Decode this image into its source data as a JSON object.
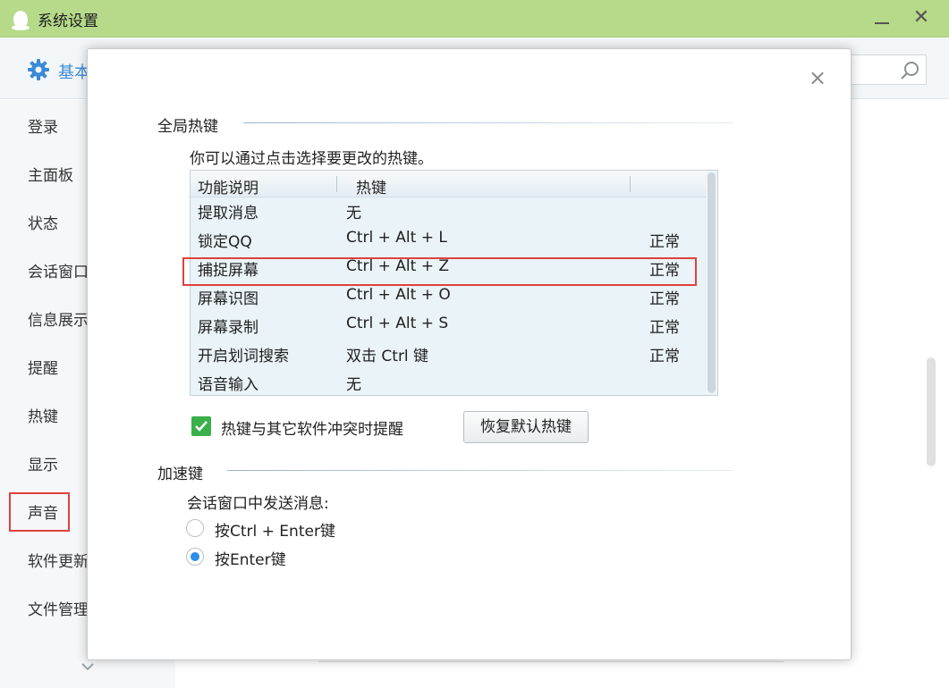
{
  "window": {
    "title": "系统设置",
    "minimize_icon": "minimize-icon",
    "close_glyph": "✕"
  },
  "background": {
    "header_label": "基本",
    "sidebar": [
      {
        "label": "登录"
      },
      {
        "label": "主面板"
      },
      {
        "label": "状态"
      },
      {
        "label": "会话窗口"
      },
      {
        "label": "信息展示"
      },
      {
        "label": "提醒"
      },
      {
        "label": "热键",
        "selected": true
      },
      {
        "label": "显示"
      },
      {
        "label": "声音"
      },
      {
        "label": "软件更新"
      },
      {
        "label": "文件管理"
      }
    ]
  },
  "modal": {
    "close_glyph": "×",
    "global_hotkeys": {
      "title": "全局热键",
      "hint": "你可以通过点击选择要更改的热键。",
      "columns": [
        "功能说明",
        "热键",
        ""
      ],
      "rows": [
        {
          "name": "提取消息",
          "key": "无",
          "status": ""
        },
        {
          "name": "锁定QQ",
          "key": "Ctrl + Alt + L",
          "status": "正常"
        },
        {
          "name": "捕捉屏幕",
          "key": "Ctrl + Alt + Z",
          "status": "正常",
          "highlighted": true
        },
        {
          "name": "屏幕识图",
          "key": "Ctrl + Alt + O",
          "status": "正常"
        },
        {
          "name": "屏幕录制",
          "key": "Ctrl + Alt + S",
          "status": "正常"
        },
        {
          "name": "开启划词搜索",
          "key": "双击 Ctrl 键",
          "status": "正常"
        },
        {
          "name": "语音输入",
          "key": "无",
          "status": ""
        }
      ],
      "conflict_checkbox": {
        "label": "热键与其它软件冲突时提醒",
        "checked": true
      },
      "restore_button": "恢复默认热键"
    },
    "accelerator": {
      "title": "加速键",
      "send_label": "会话窗口中发送消息:",
      "options": [
        {
          "label": "按Ctrl + Enter键",
          "checked": false
        },
        {
          "label": "按Enter键",
          "checked": true
        }
      ]
    }
  },
  "colors": {
    "titlebar": "#b6da8a",
    "accent": "#3a8bd6",
    "highlight_border": "#e04040",
    "checkbox_green": "#3ab04a",
    "radio_blue": "#2e8ee8"
  }
}
